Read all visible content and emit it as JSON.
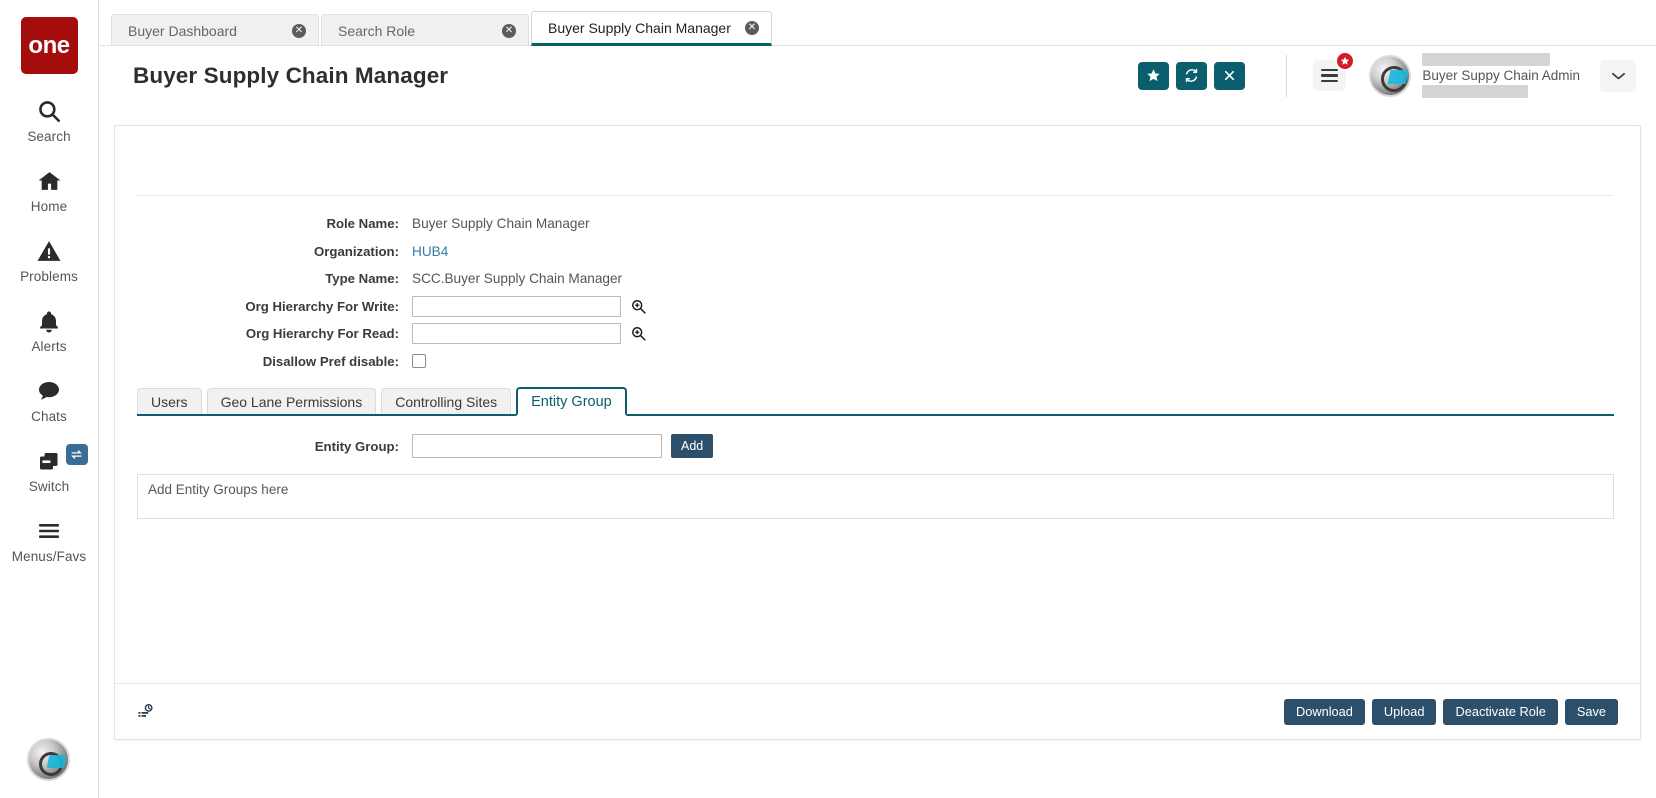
{
  "sidebar": {
    "logo_text": "one",
    "items": [
      {
        "label": "Search",
        "icon": "search-icon"
      },
      {
        "label": "Home",
        "icon": "home-icon"
      },
      {
        "label": "Problems",
        "icon": "warning-icon"
      },
      {
        "label": "Alerts",
        "icon": "bell-icon"
      },
      {
        "label": "Chats",
        "icon": "chat-icon"
      },
      {
        "label": "Switch",
        "icon": "switch-icon",
        "badge_icon": "swap-arrows-icon"
      },
      {
        "label": "Menus/Favs",
        "icon": "hamburger-icon"
      }
    ]
  },
  "tabs": [
    {
      "label": "Buyer Dashboard",
      "active": false
    },
    {
      "label": "Search Role",
      "active": false
    },
    {
      "label": "Buyer Supply Chain Manager",
      "active": true
    }
  ],
  "header": {
    "title": "Buyer Supply Chain Manager",
    "actions": [
      {
        "name": "favorite-button",
        "glyph": "★"
      },
      {
        "name": "refresh-button",
        "glyph": "⟳"
      },
      {
        "name": "close-button",
        "glyph": "✕"
      }
    ],
    "menu_badge": "★",
    "user_name": "Buyer Suppy Chain Admin",
    "chevron": "⌄"
  },
  "form": {
    "fields": [
      {
        "label": "Role Name:",
        "value": "Buyer Supply Chain Manager",
        "type": "text"
      },
      {
        "label": "Organization:",
        "value": "HUB4",
        "type": "link"
      },
      {
        "label": "Type Name:",
        "value": "SCC.Buyer Supply Chain Manager",
        "type": "text"
      },
      {
        "label": "Org Hierarchy For Write:",
        "value": "",
        "type": "input-lookup"
      },
      {
        "label": "Org Hierarchy For Read:",
        "value": "",
        "type": "input-lookup"
      },
      {
        "label": "Disallow Pref disable:",
        "value": "",
        "type": "checkbox",
        "checked": false
      }
    ]
  },
  "inner_tabs": [
    {
      "label": "Users",
      "active": false
    },
    {
      "label": "Geo Lane Permissions",
      "active": false
    },
    {
      "label": "Controlling Sites",
      "active": false
    },
    {
      "label": "Entity Group",
      "active": true
    }
  ],
  "entity_group": {
    "label": "Entity Group:",
    "input_value": "",
    "add_label": "Add",
    "dropzone_text": "Add Entity Groups here"
  },
  "footer": {
    "log_icon": "audit-log-icon",
    "buttons": [
      {
        "label": "Download",
        "name": "download-button"
      },
      {
        "label": "Upload",
        "name": "upload-button"
      },
      {
        "label": "Deactivate Role",
        "name": "deactivate-role-button"
      },
      {
        "label": "Save",
        "name": "save-button"
      }
    ]
  },
  "colors": {
    "brand_red": "#a50c0c",
    "teal": "#0b5e6e",
    "navy": "#2c506c",
    "link": "#2f7ea8",
    "badge_red": "#d31c25",
    "badge_blue": "#3a6d96"
  }
}
